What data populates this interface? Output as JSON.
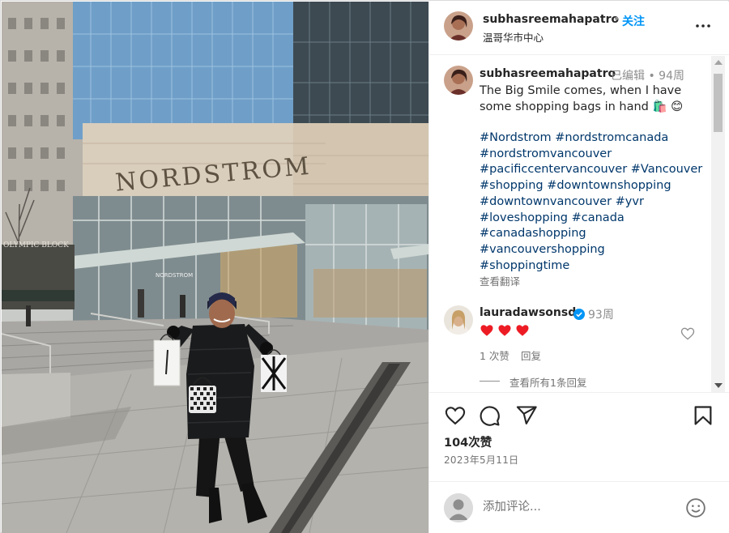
{
  "post": {
    "author": "subhasreemahapatro",
    "dot": "•",
    "follow_label": "关注",
    "location": "温哥华市中心",
    "photo_sign_text": "NORDSTROM",
    "photo_entrance_sign": "NORDSTROM",
    "photo_street_sign": "OLYMPIC BLOCK"
  },
  "caption": {
    "author": "subhasreemahapatro",
    "edited_meta": "已编辑 • 94周",
    "text": "The Big Smile comes, when I have some shopping bags in hand 🛍️ 😊",
    "hashtags": [
      "#Nordstrom #nordstromcanada",
      "#nordstromvancouver",
      "#pacificcentervancouver #Vancouver",
      "#shopping #downtownshopping",
      "#downtownvancouver #yvr",
      "#loveshopping #canada",
      "#canadashopping",
      "#vancouvershopping",
      "#shoppingtime"
    ],
    "see_translation": "查看翻译"
  },
  "reply": {
    "author": "lauradawsonsd",
    "time": "93周",
    "hearts_count": 3,
    "likes": "1 次赞",
    "reply_label": "回复",
    "view_all": "查看所有1条回复"
  },
  "actions": {
    "likes": "104次赞",
    "date": "2023年5月11日"
  },
  "composer": {
    "placeholder": "添加评论..."
  },
  "colors": {
    "link": "#00376b",
    "follow": "#0095f6",
    "muted": "#737373",
    "heart": "#ed4956",
    "verified": "#0095f6"
  }
}
